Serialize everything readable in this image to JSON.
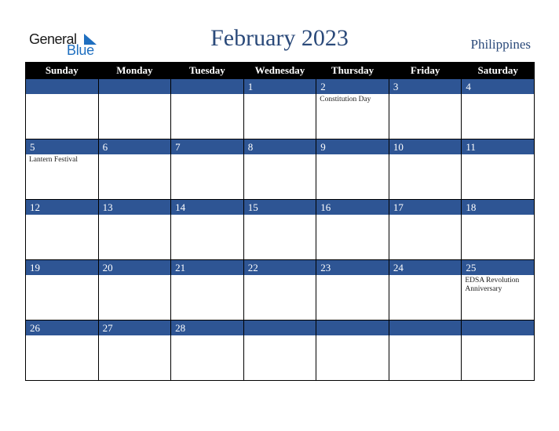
{
  "logo": {
    "word1": "General",
    "word2": "Blue"
  },
  "header": {
    "title": "February 2023",
    "country": "Philippines"
  },
  "colors": {
    "accent": "#2e5594",
    "header_bg": "#000000",
    "title": "#2b4a7a"
  },
  "weekdays": [
    "Sunday",
    "Monday",
    "Tuesday",
    "Wednesday",
    "Thursday",
    "Friday",
    "Saturday"
  ],
  "weeks": [
    [
      {
        "day": "",
        "event": ""
      },
      {
        "day": "",
        "event": ""
      },
      {
        "day": "",
        "event": ""
      },
      {
        "day": "1",
        "event": ""
      },
      {
        "day": "2",
        "event": "Constitution Day"
      },
      {
        "day": "3",
        "event": ""
      },
      {
        "day": "4",
        "event": ""
      }
    ],
    [
      {
        "day": "5",
        "event": "Lantern Festival"
      },
      {
        "day": "6",
        "event": ""
      },
      {
        "day": "7",
        "event": ""
      },
      {
        "day": "8",
        "event": ""
      },
      {
        "day": "9",
        "event": ""
      },
      {
        "day": "10",
        "event": ""
      },
      {
        "day": "11",
        "event": ""
      }
    ],
    [
      {
        "day": "12",
        "event": ""
      },
      {
        "day": "13",
        "event": ""
      },
      {
        "day": "14",
        "event": ""
      },
      {
        "day": "15",
        "event": ""
      },
      {
        "day": "16",
        "event": ""
      },
      {
        "day": "17",
        "event": ""
      },
      {
        "day": "18",
        "event": ""
      }
    ],
    [
      {
        "day": "19",
        "event": ""
      },
      {
        "day": "20",
        "event": ""
      },
      {
        "day": "21",
        "event": ""
      },
      {
        "day": "22",
        "event": ""
      },
      {
        "day": "23",
        "event": ""
      },
      {
        "day": "24",
        "event": ""
      },
      {
        "day": "25",
        "event": "EDSA Revolution Anniversary"
      }
    ],
    [
      {
        "day": "26",
        "event": ""
      },
      {
        "day": "27",
        "event": ""
      },
      {
        "day": "28",
        "event": ""
      },
      {
        "day": "",
        "event": ""
      },
      {
        "day": "",
        "event": ""
      },
      {
        "day": "",
        "event": ""
      },
      {
        "day": "",
        "event": ""
      }
    ]
  ]
}
